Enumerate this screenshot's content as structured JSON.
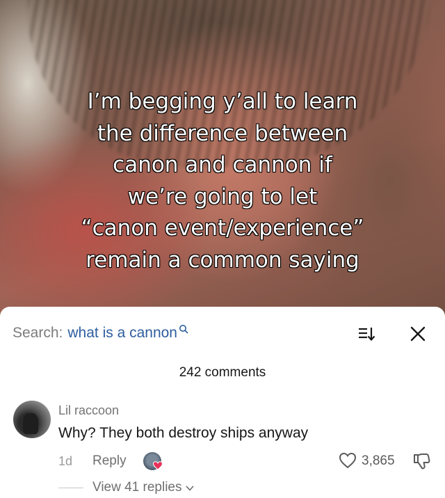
{
  "video": {
    "caption_lines": [
      "I’m begging y’all to learn",
      "the difference between",
      "canon and cannon if",
      "we’re going to let",
      "“canon event/experience”",
      "remain a common saying"
    ]
  },
  "comments_panel": {
    "search_label": "Search:",
    "search_query": "what is a cannon",
    "comment_count": "242 comments",
    "icons": {
      "search": "search-icon",
      "sort": "sort-icon",
      "close": "close-icon",
      "like": "heart-outline-icon",
      "dislike": "thumbs-down-icon",
      "chevron": "chevron-down-icon"
    },
    "comment": {
      "username": "Lil raccoon",
      "text": "Why? They both destroy ships anyway",
      "time": "1d",
      "reply_label": "Reply",
      "like_count": "3,865",
      "view_replies": "View 41 replies"
    }
  },
  "colors": {
    "search_query": "#2d5e9e",
    "creator_heart": "#e8315a"
  }
}
